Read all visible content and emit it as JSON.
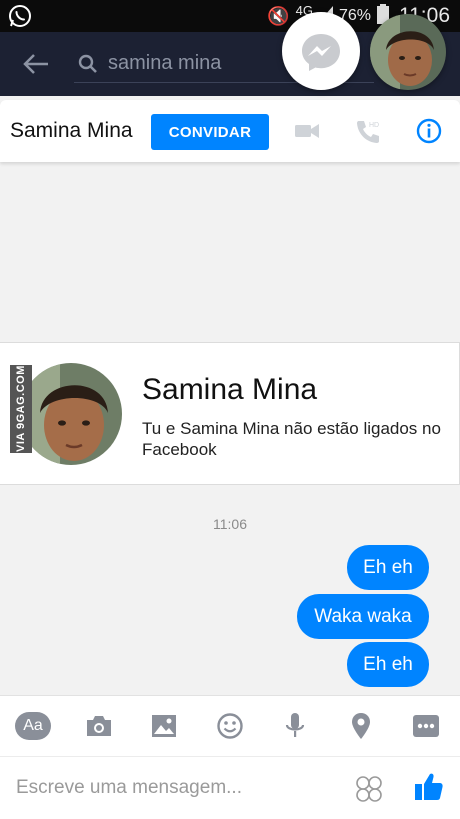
{
  "status_bar": {
    "network": "4G",
    "battery": "76%",
    "time": "11:06"
  },
  "search": {
    "query": "samina mina"
  },
  "header": {
    "contact_name": "Samina Mina",
    "invite_label": "CONVIDAR"
  },
  "profile": {
    "name": "Samina Mina",
    "description": "Tu e Samina Mina não estão ligados no Facebook"
  },
  "watermark": "VIA 9GAG.COM",
  "thread": {
    "timestamp": "11:06",
    "messages": [
      {
        "text": "Eh eh"
      },
      {
        "text": "Waka waka"
      },
      {
        "text": "Eh eh"
      }
    ]
  },
  "toolbar": {
    "text_button_label": "Aa"
  },
  "composer": {
    "placeholder": "Escreve uma mensagem..."
  },
  "colors": {
    "accent": "#0084ff",
    "search_bg": "#1c2133",
    "status_bg": "#0b0b0b"
  }
}
